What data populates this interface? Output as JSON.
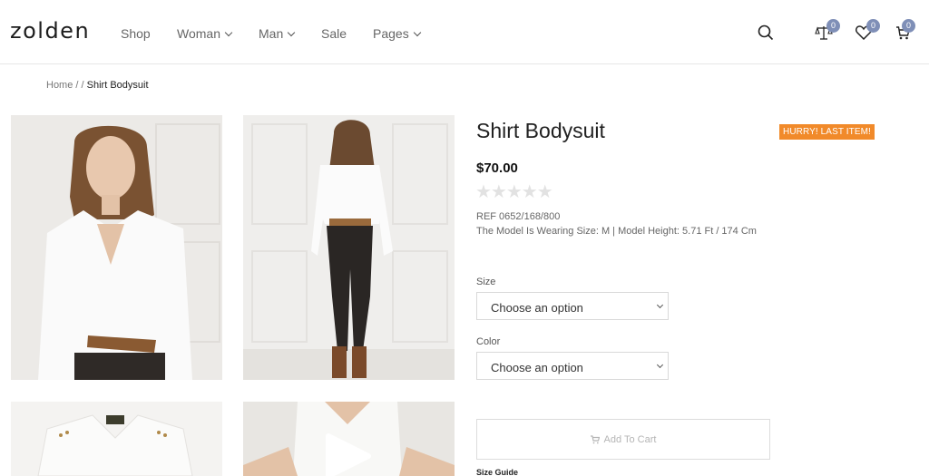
{
  "brand": {
    "logo": "zolden"
  },
  "nav": {
    "items": [
      {
        "label": "Shop",
        "has_dropdown": false
      },
      {
        "label": "Woman",
        "has_dropdown": true
      },
      {
        "label": "Man",
        "has_dropdown": true
      },
      {
        "label": "Sale",
        "has_dropdown": false
      },
      {
        "label": "Pages",
        "has_dropdown": true
      }
    ]
  },
  "header_icons": {
    "search": "search-icon",
    "compare": {
      "icon": "scale-icon",
      "count": "0"
    },
    "wishlist": {
      "icon": "heart-icon",
      "count": "0"
    },
    "cart": {
      "icon": "cart-icon",
      "count": "0"
    }
  },
  "breadcrumb": {
    "home": "Home",
    "sep1": "/",
    "sep2": "/",
    "current": "Shirt Bodysuit"
  },
  "product": {
    "title": "Shirt Bodysuit",
    "badge": "HURRY! LAST ITEM!",
    "price": "$70.00",
    "rating_stars": "★★★★★",
    "rating_value": 0,
    "ref": "REF 0652/168/800",
    "model_info": "The Model Is Wearing Size: M | Model Height: 5.71 Ft / 174 Cm",
    "size": {
      "label": "Size",
      "value": "Choose an option"
    },
    "color": {
      "label": "Color",
      "value": "Choose an option"
    },
    "add_to_cart": "Add To Cart",
    "size_guide": "Size Guide"
  },
  "colors": {
    "badge_bg": "#f18a2a",
    "counter_badge_bg": "#7f8fb7"
  }
}
